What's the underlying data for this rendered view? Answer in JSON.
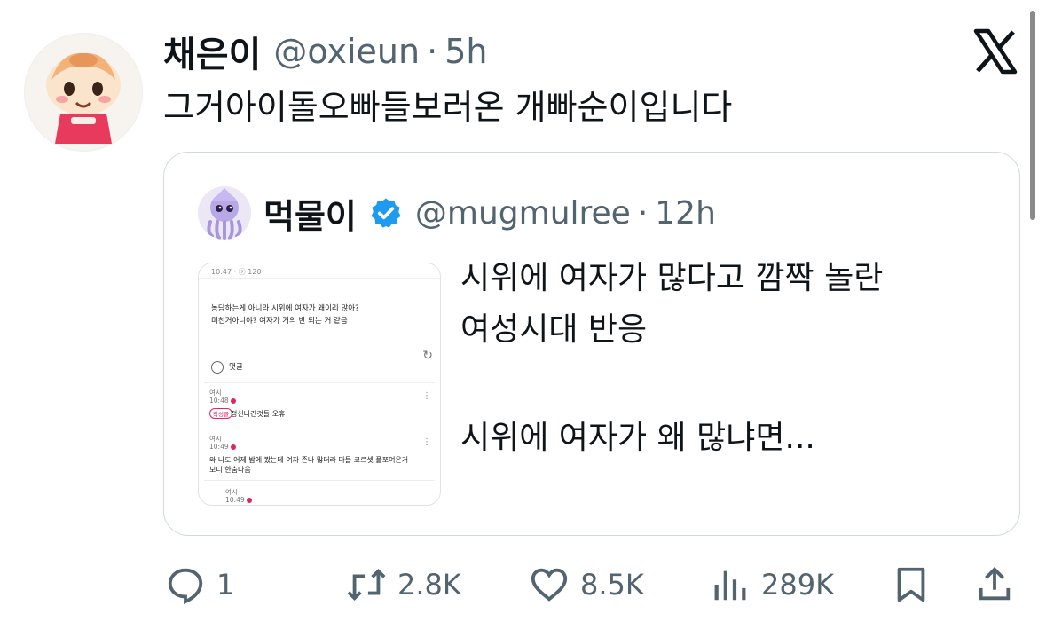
{
  "tweet": {
    "author_name": "채은이",
    "handle": "@oxieun",
    "separator": "·",
    "time": "5h",
    "text": "그거아이돌오빠들보러온 개빠순이입니다",
    "avatar_icon": "character-avatar-icon",
    "brand_icon": "x-logo-icon"
  },
  "quote": {
    "author_name": "먹물이",
    "verified_icon": "verified-badge-icon",
    "handle": "@mugmulree",
    "separator": "·",
    "time": "12h",
    "text_lines": [
      "시위에 여자가 많다고 깜짝 놀란",
      "여성시대 반응",
      "시위에 여자가 왜 많냐면..."
    ]
  },
  "media": {
    "status": "10:47 · ⓢ 120",
    "post_lines": [
      "농담하는게 아니라 시위에 여자가 왜이리 많아?",
      "미친거아니야? 여자가 거의 반 되는 거 같음"
    ],
    "comment_label": "댓글",
    "comments": [
      {
        "author": "여시",
        "time": "10:48",
        "badge": "작성글",
        "text": [
          "정신나간것들 오휴"
        ]
      },
      {
        "author": "여시",
        "time": "10:49",
        "badge": "",
        "text": [
          "와 나도 어제 밤에 봤는데 여자 존나 많더라 다들 코르셋 풀쪼여온거",
          "보니 한숨나옴"
        ]
      },
      {
        "author": "여시",
        "time": "10:49",
        "badge": "",
        "text": []
      }
    ]
  },
  "actions": {
    "reply": {
      "icon": "reply-icon",
      "count": "1"
    },
    "retweet": {
      "icon": "retweet-icon",
      "count": "2.8K"
    },
    "like": {
      "icon": "heart-icon",
      "count": "8.5K"
    },
    "views": {
      "icon": "analytics-icon",
      "count": "289K"
    },
    "bookmark": {
      "icon": "bookmark-icon"
    },
    "share": {
      "icon": "share-icon"
    }
  },
  "colors": {
    "text_primary": "#0f1419",
    "text_secondary": "#536471",
    "border": "#cfd9de",
    "verified_blue": "#1d9bf0"
  }
}
